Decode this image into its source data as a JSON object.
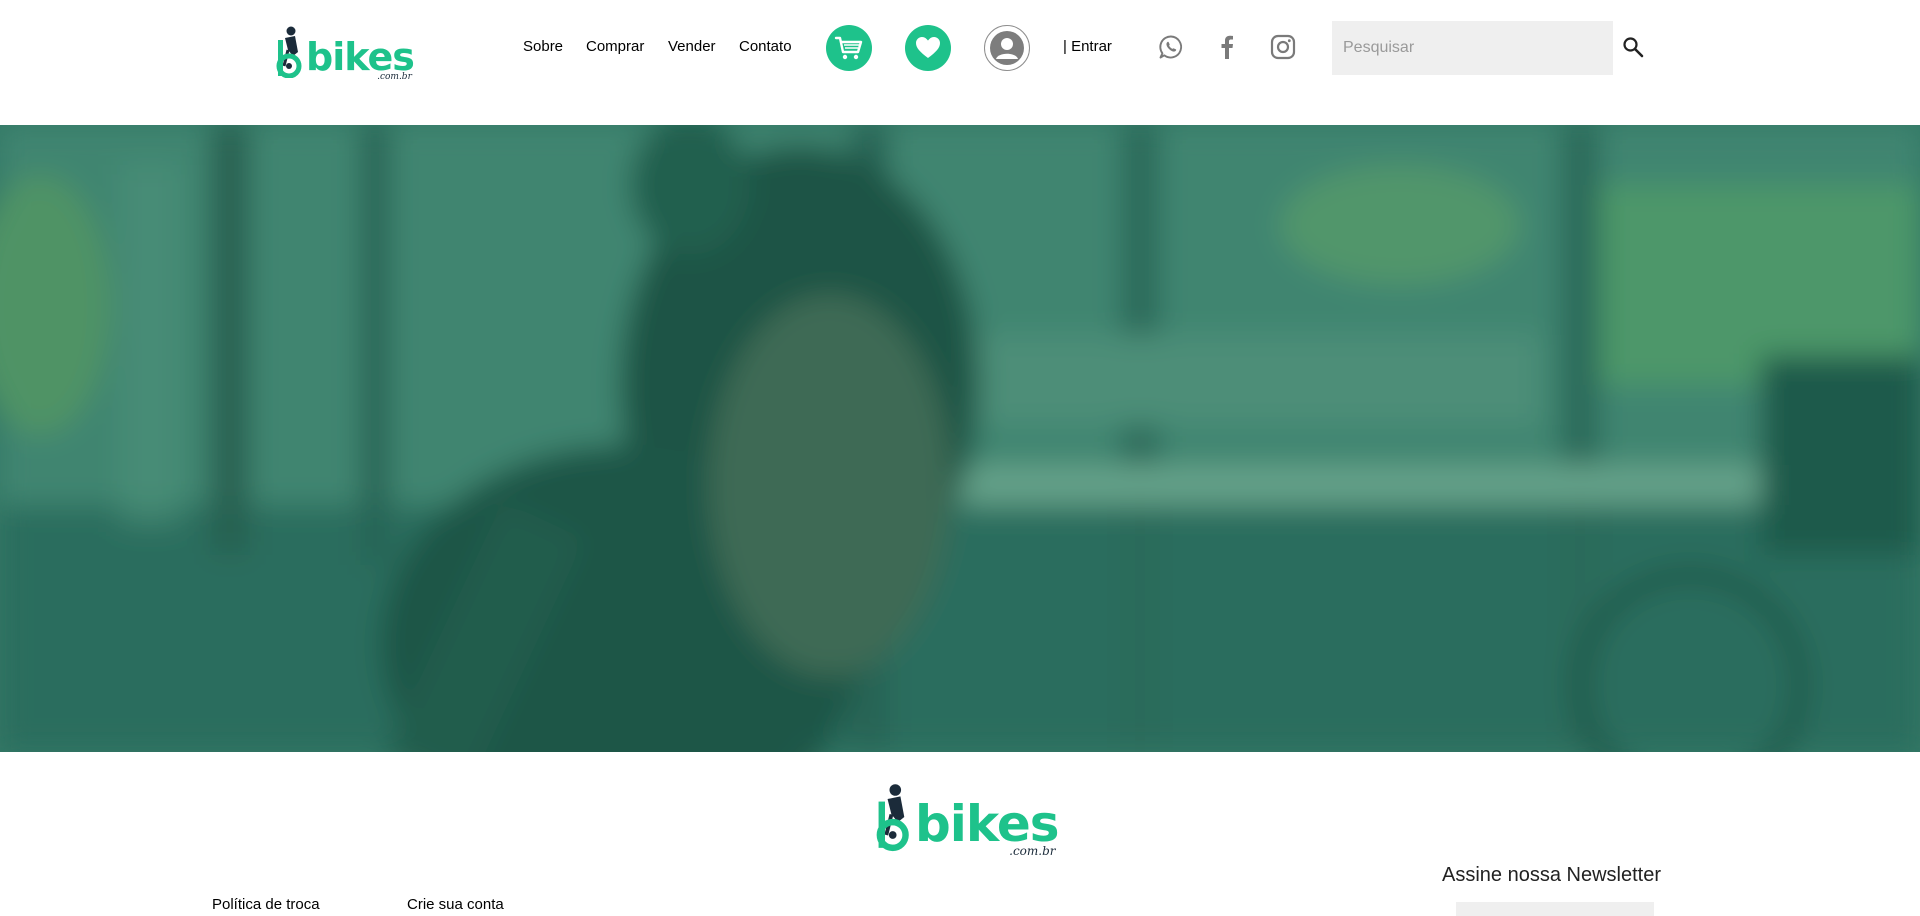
{
  "brand": {
    "name": "bikes",
    "suffix": ".com.br",
    "color_primary": "#1ec28b",
    "color_dark": "#1b2b3a"
  },
  "nav": {
    "items": [
      {
        "label": "Sobre"
      },
      {
        "label": "Comprar"
      },
      {
        "label": "Vender"
      },
      {
        "label": "Contato"
      }
    ]
  },
  "actions": {
    "cart_icon": "cart-icon",
    "favorites_icon": "heart-icon",
    "account_icon": "user-icon",
    "login_label": "| Entrar"
  },
  "social": {
    "icons": [
      "whatsapp-icon",
      "facebook-icon",
      "instagram-icon"
    ]
  },
  "search": {
    "placeholder": "Pesquisar",
    "value": ""
  },
  "hero": {
    "overlay_color": "#1f6b58"
  },
  "footer": {
    "links": [
      {
        "label": "Política de troca"
      },
      {
        "label": "Crie sua conta"
      }
    ],
    "newsletter_title": "Assine nossa Newsletter"
  }
}
